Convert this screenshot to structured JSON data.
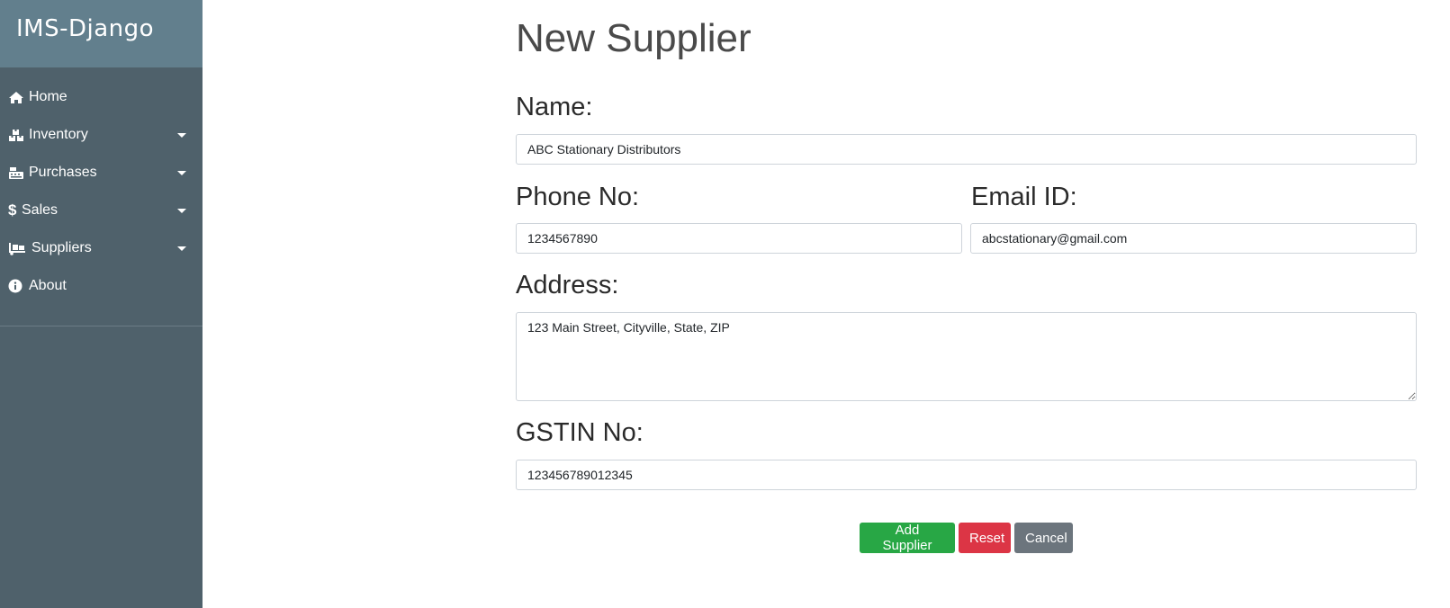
{
  "app": {
    "brand": "IMS-Django"
  },
  "sidebar": {
    "items": [
      {
        "label": "Home",
        "icon": "home-icon",
        "dropdown": false
      },
      {
        "label": "Inventory",
        "icon": "boxes-icon",
        "dropdown": true
      },
      {
        "label": "Purchases",
        "icon": "cash-register-icon",
        "dropdown": true
      },
      {
        "label": "Sales",
        "icon": "dollar-icon",
        "dropdown": true
      },
      {
        "label": "Suppliers",
        "icon": "dolly-icon",
        "dropdown": true
      },
      {
        "label": "About",
        "icon": "info-icon",
        "dropdown": false
      }
    ]
  },
  "form": {
    "title": "New Supplier",
    "name_label": "Name:",
    "name_value": "ABC Stationary Distributors",
    "phone_label": "Phone No:",
    "phone_value": "1234567890",
    "email_label": "Email ID:",
    "email_value": "abcstationary@gmail.com",
    "address_label": "Address:",
    "address_value": "123 Main Street, Cityville, State, ZIP",
    "gstin_label": "GSTIN No:",
    "gstin_value": "123456789012345"
  },
  "actions": {
    "add_label": "Add Supplier",
    "reset_label": "Reset",
    "cancel_label": "Cancel"
  },
  "colors": {
    "sidebar_bg": "#4f616b",
    "brand_bg": "#627f8d",
    "success": "#28a745",
    "danger": "#dc3545",
    "secondary": "#6c757d"
  }
}
